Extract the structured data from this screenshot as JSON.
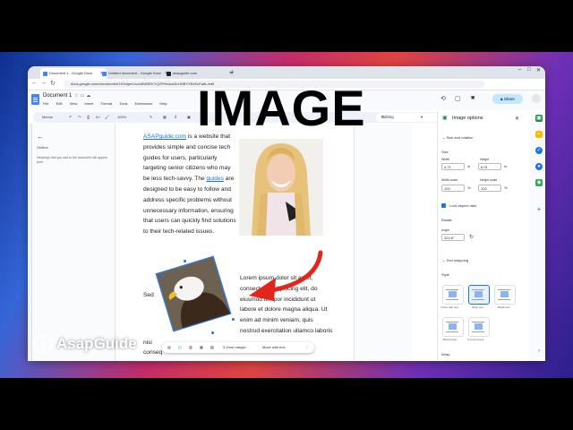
{
  "browser": {
    "tabs": [
      {
        "label": "Document 1 - Google Docs",
        "color": "#4285f4",
        "active": true
      },
      {
        "label": "Untitled document - Google Docs",
        "color": "#4285f4",
        "active": false
      },
      {
        "label": "asapguide.com",
        "color": "#222222",
        "active": false
      }
    ],
    "url": "docs.google.com/document/d/1K0dqmCxu4AfW9EKYQZFf9s4zn2k1fHBYXEeEuFa6L/edit"
  },
  "docs": {
    "title": "Document 1",
    "menus": [
      "File",
      "Edit",
      "View",
      "Insert",
      "Format",
      "Tools",
      "Extensions",
      "Help"
    ],
    "share_label": "Share",
    "toolbar": {
      "search": "Menus",
      "zoom": "100%",
      "mode": "Editing"
    }
  },
  "outline": {
    "title": "Outline",
    "hint": "Headings that you add to the document will appear here."
  },
  "document": {
    "link1": "ASAPguide.com",
    "p1a": " is a website that provides simple and concise tech guides for users, particularly targeting senior citizens who may be less tech-savvy. The ",
    "link2": "guides",
    "p1b": " are designed to  be easy to follow and address specific problems without  unnecessary information, ensuring that users can quickly find solutions to their tech-related issues.",
    "sec": "Sed",
    "lorem": "Lorem ipsum dolor sit amet, consectetur adipiscing elit, do eiusmod tempor incididunt ut labore et dolore magna aliqua. Ut enim ad minim veniam, quis nostrud exercitation ullamco laboris",
    "bottom1": "nisi",
    "bottom2": "conseq"
  },
  "image_toolbar": {
    "margin": "3.2mm margin",
    "move": "Move with text"
  },
  "image_options": {
    "title": "Image options",
    "size_section": "Size and rotation",
    "size_label": "Size",
    "width_label": "Width",
    "width_value": "4.71",
    "height_label": "Height",
    "height_value": "6.01",
    "unit": "in",
    "width_scale_label": "Width scale",
    "width_scale_value": "100",
    "height_scale_label": "Height scale",
    "height_scale_value": "100",
    "percent": "%",
    "lock_label": "Lock aspect ratio",
    "rotate_label": "Rotate",
    "angle_label": "Angle",
    "angle_value": "324.6°",
    "text_wrapping": "Text wrapping",
    "style_label": "Style",
    "wrap_options": [
      "In line with text",
      "Wrap text",
      "Break text",
      "Behind text",
      "In front of text"
    ],
    "wrap_label": "Wrap"
  },
  "overlay": {
    "title": "IMAGE",
    "brand": "AsapGuide"
  },
  "colors": {
    "accent": "#1a73e8",
    "share": "#c2e7ff",
    "arrow": "#e3261c"
  }
}
